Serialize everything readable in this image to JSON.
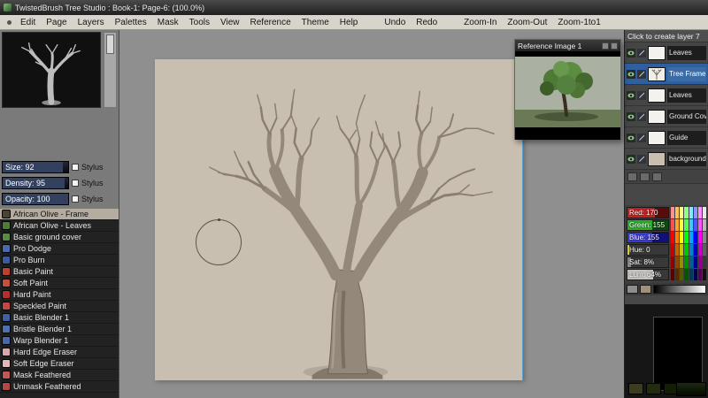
{
  "window": {
    "title": "TwistedBrush Tree Studio : Book-1: Page-6:  (100.0%)"
  },
  "menu": {
    "items": [
      "Edit",
      "Page",
      "Layers",
      "Palettes",
      "Mask",
      "Tools",
      "View",
      "Reference",
      "Theme",
      "Help"
    ],
    "actions": [
      "Undo",
      "Redo"
    ],
    "zoom": [
      "Zoom-In",
      "Zoom-Out",
      "Zoom-1to1"
    ]
  },
  "left_panel": {
    "params": [
      {
        "label": "Size: 92",
        "stylus": "Stylus",
        "fill": 0.92
      },
      {
        "label": "Density: 95",
        "stylus": "Stylus",
        "fill": 0.95
      },
      {
        "label": "Opacity: 100",
        "stylus": "Stylus",
        "fill": 1.0
      }
    ],
    "brushes": [
      {
        "label": "African Olive - Frame",
        "color": "#4a4434",
        "selected": true
      },
      {
        "label": "African Olive - Leaves",
        "color": "#4e7a3a"
      },
      {
        "label": "Basic ground cover",
        "color": "#5a8a46"
      },
      {
        "label": "Pro Dodge",
        "color": "#4a6aaa"
      },
      {
        "label": "Pro Burn",
        "color": "#3a5a9a"
      },
      {
        "label": "Basic Paint",
        "color": "#c04030"
      },
      {
        "label": "Soft Paint",
        "color": "#c05040"
      },
      {
        "label": "Hard Paint",
        "color": "#b03030"
      },
      {
        "label": "Speckled Paint",
        "color": "#c04848"
      },
      {
        "label": "Basic Blender 1",
        "color": "#4060a0"
      },
      {
        "label": "Bristle Blender 1",
        "color": "#5070b0"
      },
      {
        "label": "Warp Blender 1",
        "color": "#4868a8"
      },
      {
        "label": "Hard Edge Eraser",
        "color": "#d8a8a8"
      },
      {
        "label": "Soft Edge Eraser",
        "color": "#e0b8b8"
      },
      {
        "label": "Mask Feathered",
        "color": "#c05858"
      },
      {
        "label": "Unmask Feathered",
        "color": "#b04848"
      }
    ]
  },
  "reference_panel": {
    "title": "Reference Image 1"
  },
  "right_panel": {
    "header": "Click to create layer 7",
    "layers": [
      {
        "label": "Leaves",
        "thumb": "blank"
      },
      {
        "label": "Tree Frame",
        "thumb": "tree",
        "selected": true
      },
      {
        "label": "Leaves",
        "thumb": "blank"
      },
      {
        "label": "Ground Cover",
        "thumb": "blank"
      },
      {
        "label": "Guide",
        "thumb": "blank"
      },
      {
        "label": "background",
        "thumb": "beige"
      }
    ],
    "color_sliders": [
      {
        "label": "Red: 170",
        "bg": "#5a0c0c",
        "fill": 0.67,
        "fillColor": "#c82020"
      },
      {
        "label": "Green: 155",
        "bg": "#0a4a0a",
        "fill": 0.61,
        "fillColor": "#2ab02a"
      },
      {
        "label": "Blue: 155",
        "bg": "#101078",
        "fill": 0.61,
        "fillColor": "#3a3ad8"
      },
      {
        "label": "Hue: 0",
        "bg": "#383838",
        "fill": 0.05,
        "fillColor": "#e0d830"
      },
      {
        "label": "Sat: 8%",
        "bg": "#383838",
        "fill": 0.08,
        "fillColor": "#8a8a8a"
      },
      {
        "label": "Lum: 64%",
        "bg": "#383838",
        "fill": 0.64,
        "fillColor": "#c8c4c0"
      }
    ],
    "palette": [
      "#ff9090",
      "#ffc060",
      "#ffff80",
      "#90ff90",
      "#80e8ff",
      "#9090ff",
      "#ff90ff",
      "#e8e8e8",
      "#ff5050",
      "#ffa030",
      "#ffff40",
      "#50ff50",
      "#40c8ff",
      "#5050ff",
      "#ff50ff",
      "#b8b8b8",
      "#ff0000",
      "#ff8000",
      "#ffff00",
      "#00ff00",
      "#00a8ff",
      "#0000ff",
      "#ff00ff",
      "#888888",
      "#c80000",
      "#c86400",
      "#c8c800",
      "#00c800",
      "#0084c8",
      "#0000c8",
      "#c800c8",
      "#606060",
      "#900000",
      "#904800",
      "#909000",
      "#009000",
      "#006090",
      "#000090",
      "#900090",
      "#383838",
      "#580000",
      "#582c00",
      "#585800",
      "#005800",
      "#003c58",
      "#000058",
      "#580058",
      "#101010"
    ],
    "gradient_swatches": [
      "#8e8e8e",
      "#a09080"
    ],
    "current_color": "#000000",
    "secondary_swatches": [
      "#3c3c20",
      "#222c10",
      "#141e06"
    ]
  }
}
